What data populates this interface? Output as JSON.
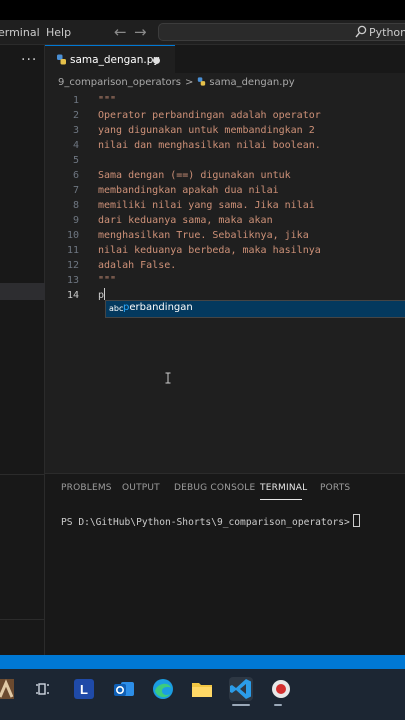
{
  "menu": {
    "terminal": "erminal",
    "help": "Help"
  },
  "search": {
    "text": "Python-S"
  },
  "tab": {
    "filename": "sama_dengan.py"
  },
  "breadcrumb": {
    "folder": "9_comparison_operators",
    "separator": ">",
    "file": "sama_dengan.py"
  },
  "editor": {
    "line_numbers": [
      "1",
      "2",
      "3",
      "4",
      "5",
      "6",
      "7",
      "8",
      "9",
      "10",
      "11",
      "12",
      "13",
      "14"
    ],
    "lines": [
      "\"\"\"",
      "Operator perbandingan adalah operator",
      "yang digunakan untuk membandingkan 2",
      "nilai dan menghasilkan nilai boolean.",
      "",
      "Sama dengan (==) digunakan untuk",
      "membandingkan apakah dua nilai",
      "memiliki nilai yang sama. Jika nilai",
      "dari keduanya sama, maka akan",
      "menghasilkan True. Sebaliknya, jika",
      "nilai keduanya berbeda, maka hasilnya",
      "adalah False.",
      "\"\"\"",
      "p"
    ]
  },
  "suggestion": {
    "kind": "abc",
    "match": "p",
    "rest": "erbandingan"
  },
  "panel": {
    "tabs": [
      "PROBLEMS",
      "OUTPUT",
      "DEBUG CONSOLE",
      "TERMINAL",
      "PORTS"
    ],
    "active_tab": "TERMINAL",
    "prompt": "PS D:\\GitHub\\Python-Shorts\\9_comparison_operators>"
  },
  "taskbar": {
    "l_label": "L"
  },
  "colors": {
    "accent": "#0078d4",
    "string": "#ce9178",
    "editor_bg": "#1f1f1f",
    "suggest_bg": "#04395e",
    "taskbar_bg": "#1c2633"
  }
}
